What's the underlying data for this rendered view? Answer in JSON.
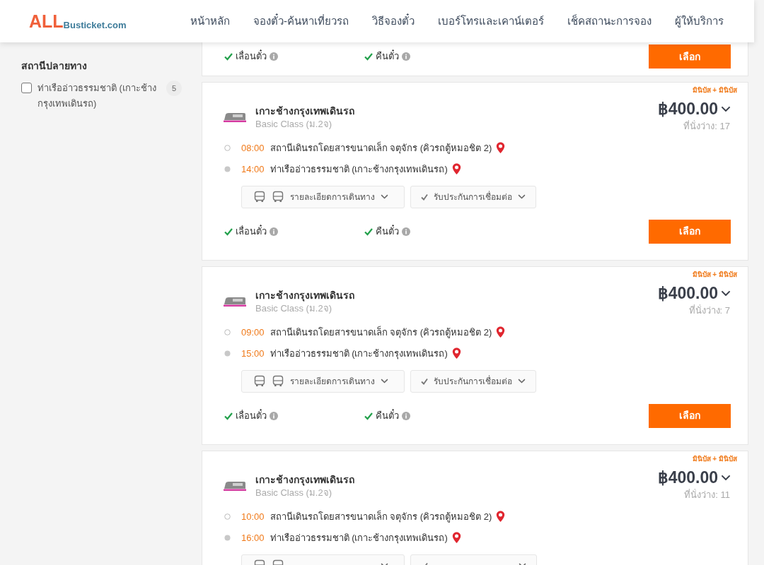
{
  "header": {
    "logo": {
      "accent": "ALL",
      "rest": "Busticket.com"
    },
    "nav": [
      "หน้าหลัก",
      "จองตั๋ว-ค้นหาเที่ยวรถ",
      "วิธีจองตั๋ว",
      "เบอร์โทรและเคาน์เตอร์",
      "เช็คสถานะการจอง",
      "ผู้ให้บริการ"
    ]
  },
  "sidebar": {
    "section_title": "สถานีปลายทาง",
    "options": [
      {
        "label": "ท่าเรืออ่าวธรรมชาติ (เกาะช้างกรุงเทพเดินรถ)",
        "count": "5",
        "checked": false
      }
    ]
  },
  "partial_trip": {
    "reschedule": "เลื่อนตั๋ว",
    "refund": "คืนตั๋ว",
    "select_button": "เลือก"
  },
  "trips": [
    {
      "tag": "มินิบัส + มินิบัส",
      "operator": "เกาะช้างกรุงเทพเดินรถ",
      "class": "Basic Class (ม.2จ)",
      "price": "฿400.00",
      "seats": "ที่นั่งว่าง: 17",
      "stops": [
        {
          "time": "08:00",
          "place": "สถานีเดินรถโดยสารขนาดเล็ก จตุจักร (คิวรถตู้หมอชิต 2)"
        },
        {
          "time": "14:00",
          "place": "ท่าเรืออ่าวธรรมชาติ (เกาะช้างกรุงเทพเดินรถ)"
        }
      ],
      "details_button": "รายละเอียดการเดินทาง",
      "guarantee_button": "รับประกันการเชื่อมต่อ",
      "reschedule": "เลื่อนตั๋ว",
      "refund": "คืนตั๋ว",
      "select_button": "เลือก"
    },
    {
      "tag": "มินิบัส + มินิบัส",
      "operator": "เกาะช้างกรุงเทพเดินรถ",
      "class": "Basic Class (ม.2จ)",
      "price": "฿400.00",
      "seats": "ที่นั่งว่าง: 7",
      "stops": [
        {
          "time": "09:00",
          "place": "สถานีเดินรถโดยสารขนาดเล็ก จตุจักร (คิวรถตู้หมอชิต 2)"
        },
        {
          "time": "15:00",
          "place": "ท่าเรืออ่าวธรรมชาติ (เกาะช้างกรุงเทพเดินรถ)"
        }
      ],
      "details_button": "รายละเอียดการเดินทาง",
      "guarantee_button": "รับประกันการเชื่อมต่อ",
      "reschedule": "เลื่อนตั๋ว",
      "refund": "คืนตั๋ว",
      "select_button": "เลือก"
    },
    {
      "tag": "มินิบัส + มินิบัส",
      "operator": "เกาะช้างกรุงเทพเดินรถ",
      "class": "Basic Class (ม.2จ)",
      "price": "฿400.00",
      "seats": "ที่นั่งว่าง: 11",
      "stops": [
        {
          "time": "10:00",
          "place": "สถานีเดินรถโดยสารขนาดเล็ก จตุจักร (คิวรถตู้หมอชิต 2)"
        },
        {
          "time": "16:00",
          "place": "ท่าเรืออ่าวธรรมชาติ (เกาะช้างกรุงเทพเดินรถ)"
        }
      ]
    }
  ]
}
